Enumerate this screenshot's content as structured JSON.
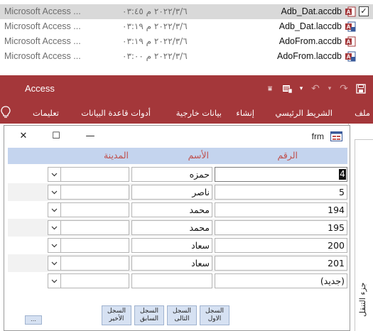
{
  "files": [
    {
      "type": "Microsoft Access ...",
      "date": "٢٠٢٢/٣/٦ م ٠٣:٤٥",
      "name": "Adb_Dat.accdb",
      "icon": "access-db-icon",
      "checked": true
    },
    {
      "type": "Microsoft Access ...",
      "date": "٢٠٢٢/٣/٦ م ٠٣:١٩",
      "name": "Adb_Dat.laccdb",
      "icon": "access-lock-icon",
      "checked": false
    },
    {
      "type": "Microsoft Access ...",
      "date": "٢٠٢٢/٣/٦ م ٠٣:١٩",
      "name": "AdoFrom.accdb",
      "icon": "access-db-icon",
      "checked": false
    },
    {
      "type": "Microsoft Access ...",
      "date": "٢٠٢٢/٣/٦ م ٠٣:٠٠",
      "name": "AdoFrom.laccdb",
      "icon": "access-lock-icon",
      "checked": false
    }
  ],
  "app": {
    "title": "Access",
    "accent": "#a4373a"
  },
  "ribbon": {
    "tabs": [
      "ملف",
      "الشريط الرئيسي",
      "إنشاء",
      "بيانات خارجية",
      "أدوات قاعدة البيانات",
      "تعليمات"
    ]
  },
  "nav_pane": {
    "label": "جزء التنقل"
  },
  "form": {
    "title": "frm",
    "headers": {
      "id": "الرقم",
      "name": "الأسم",
      "city": "المدينة"
    },
    "rows": [
      {
        "id": "4",
        "name": "حمزه",
        "city": ""
      },
      {
        "id": "5",
        "name": "ناصر",
        "city": ""
      },
      {
        "id": "194",
        "name": "محمد",
        "city": ""
      },
      {
        "id": "195",
        "name": "محمد",
        "city": ""
      },
      {
        "id": "200",
        "name": "سعاد",
        "city": ""
      },
      {
        "id": "201",
        "name": "سعاد",
        "city": ""
      },
      {
        "id": "(جديد)",
        "name": "",
        "city": ""
      }
    ],
    "nav_buttons": [
      "السجل الاول",
      "السجل التالى",
      "السجل السابق",
      "السجل الأخير"
    ]
  }
}
